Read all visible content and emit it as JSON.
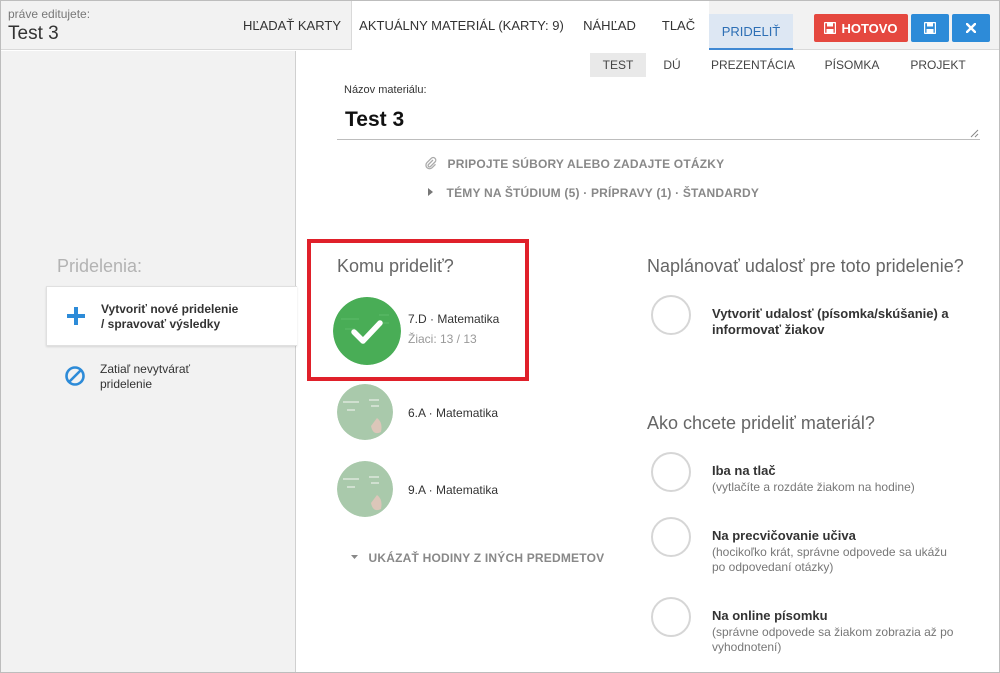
{
  "header": {
    "editing_label": "práve editujete:",
    "doc_title": "Test 3",
    "tabs": [
      {
        "label": "HĽADAŤ KARTY"
      },
      {
        "label": "AKTUÁLNY MATERIÁL (KARTY: 9)"
      },
      {
        "label": "NÁHĽAD"
      },
      {
        "label": "TLAČ"
      },
      {
        "label": "PRIDELIŤ"
      }
    ],
    "done_label": "HOTOVO",
    "save_icon": "floppy-icon",
    "close_icon": "close-icon",
    "colors": {
      "done": "#e5483f",
      "action": "#2d8bd8",
      "active_tab": "#dde7f3"
    }
  },
  "sidebar": {
    "title": "Pridelenia:",
    "items": [
      {
        "line1": "Vytvoriť nové pridelenie",
        "line2": "/ spravovať výsledky",
        "icon": "plus-icon"
      },
      {
        "line1": "Zatiaľ nevytvárať",
        "line2": "pridelenie",
        "icon": "ban-icon"
      }
    ]
  },
  "material": {
    "type_tabs": [
      "TEST",
      "DÚ",
      "PREZENTÁCIA",
      "PÍSOMKA",
      "PROJEKT"
    ],
    "name_label": "Názov materiálu:",
    "name_value": "Test 3",
    "attach_link": "PRIPOJTE SÚBORY ALEBO ZADAJTE OTÁZKY",
    "topics_link": "TÉMY NA ŠTÚDIUM (5) · PRÍPRAVY (1) · ŠTANDARDY"
  },
  "assign": {
    "title": "Komu prideliť?",
    "classes": [
      {
        "name": "7.D · Matematika",
        "students": "Žiaci: 13 / 13"
      },
      {
        "name": "6.A · Matematika"
      },
      {
        "name": "9.A · Matematika"
      }
    ],
    "more_link": "UKÁZAŤ HODINY Z INÝCH PREDMETOV"
  },
  "schedule": {
    "title": "Naplánovať udalosť pre toto pridelenie?",
    "option": {
      "line1": "Vytvoriť udalosť (písomka/skúšanie) a",
      "line2": "informovať žiakov"
    }
  },
  "mode": {
    "title": "Ako chcete prideliť materiál?",
    "options": [
      {
        "title": "Iba na tlač",
        "desc1": "(vytlačíte a rozdáte žiakom na hodine)",
        "desc2": ""
      },
      {
        "title": "Na precvičovanie učiva",
        "desc1": "(hocikoľko krát, správne odpovede sa ukážu",
        "desc2": "po odpovedaní otázky)"
      },
      {
        "title": "Na online písomku",
        "desc1": "(správne odpovede sa žiakom zobrazia až po",
        "desc2": "vyhodnotení)"
      }
    ]
  }
}
